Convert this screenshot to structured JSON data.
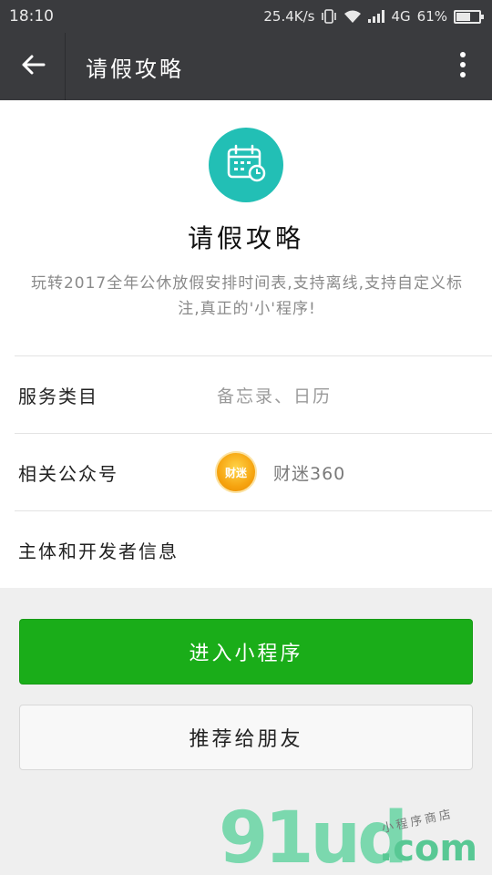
{
  "status_bar": {
    "time": "18:10",
    "network_speed": "25.4K/s",
    "network_type": "4G",
    "battery": "61%",
    "battery_level": 0.61
  },
  "title_bar": {
    "title": "请假攻略",
    "back_icon": "arrow-left-icon",
    "more_icon": "more-vertical-icon"
  },
  "app": {
    "name": "请假攻略",
    "description": "玩转2017全年公休放假安排时间表,支持离线,支持自定义标注,真正的'小'程序!",
    "icon": "calendar-clock-icon",
    "icon_color": "#22bfb5"
  },
  "details": {
    "service_category_label": "服务类目",
    "service_category_value": "备忘录、日历",
    "related_account_label": "相关公众号",
    "related_account_name": "财迷360",
    "related_account_avatar_text": "财迷",
    "developer_info_label": "主体和开发者信息"
  },
  "actions": {
    "enter_label": "进入小程序",
    "recommend_label": "推荐给朋友",
    "primary_color": "#1aad19"
  },
  "watermark": {
    "main": "91ud",
    "domain": ".com",
    "sub": "小程序商店"
  }
}
